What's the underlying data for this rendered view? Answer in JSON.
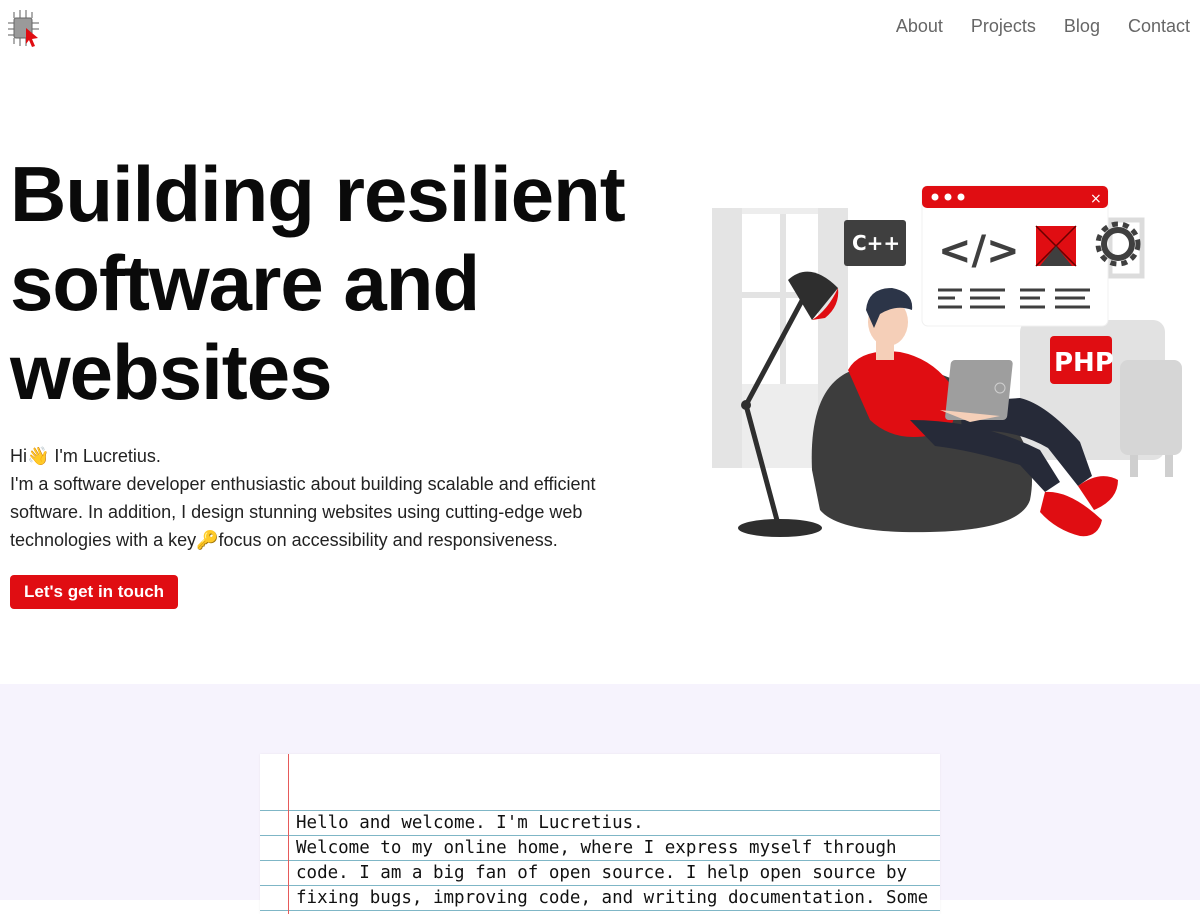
{
  "header": {
    "logo_icon": "chip-cursor-logo-icon",
    "nav": [
      {
        "label": "About"
      },
      {
        "label": "Projects"
      },
      {
        "label": "Blog"
      },
      {
        "label": "Contact"
      }
    ]
  },
  "hero": {
    "title": "Building resilient software and websites",
    "greeting_before": "Hi",
    "greeting_emoji": "👋",
    "greeting_after": " I'm Lucretius.",
    "desc_before": "I'm a software developer enthusiastic about building scalable and efficient software. In addition, I design stunning websites using cutting-edge web technologies with a key",
    "desc_emoji": "🔑",
    "desc_after": "focus on accessibility and responsiveness.",
    "cta_label": "Let's get in touch",
    "illustration": {
      "badge_cpp": "C++",
      "badge_php": "PHP",
      "code_symbol": "</>",
      "close_glyph": "×"
    }
  },
  "notebook": {
    "line1": "Hello and welcome. I'm Lucretius.",
    "line2": "Welcome to my online home, where I express myself through code. I am a big fan of open source. I help open source by fixing bugs, improving code, and writing documentation. Some"
  },
  "colors": {
    "accent": "#e00d12",
    "nav_text": "#666666",
    "section_bg": "#f6f3fd",
    "dark_gray": "#3f3f3f"
  }
}
